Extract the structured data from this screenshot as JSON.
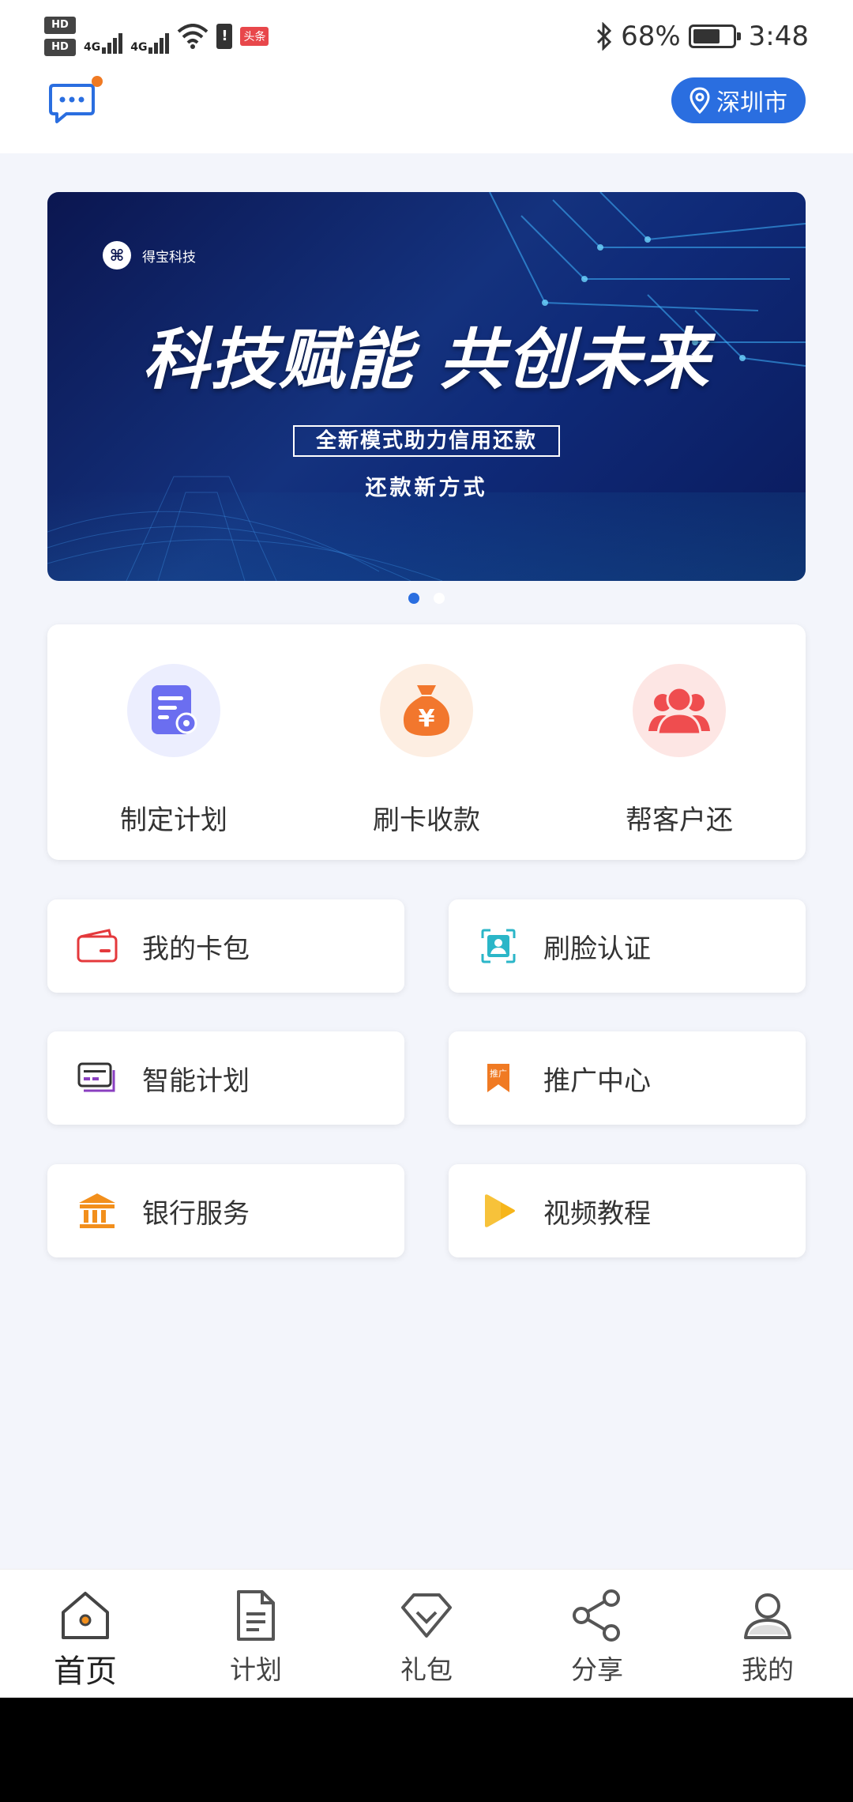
{
  "status_bar": {
    "hd1": "HD",
    "hd2": "HD",
    "net1": "4G",
    "net2": "4G",
    "app_badge": "头条",
    "battery_percent": "68%",
    "battery_level": 0.68,
    "time": "3:48"
  },
  "header": {
    "city": "深圳市",
    "has_unread_messages": true
  },
  "banner": {
    "brand": "得宝科技",
    "headline": "科技赋能 共创未来",
    "boxed_text": "全新模式助力信用还款",
    "subtitle": "还款新方式",
    "page_count": 2,
    "active_page": 1
  },
  "main_actions": [
    {
      "label": "制定计划",
      "icon": "plan-doc-icon"
    },
    {
      "label": "刷卡收款",
      "icon": "money-bag-icon"
    },
    {
      "label": "帮客户还",
      "icon": "users-icon"
    }
  ],
  "tiles": [
    {
      "label": "我的卡包",
      "icon": "card-wallet-icon"
    },
    {
      "label": "刷脸认证",
      "icon": "face-id-icon"
    },
    {
      "label": "智能计划",
      "icon": "smart-plan-icon"
    },
    {
      "label": "推广中心",
      "icon": "promo-bookmark-icon",
      "icon_text": "推广"
    },
    {
      "label": "银行服务",
      "icon": "bank-icon"
    },
    {
      "label": "视频教程",
      "icon": "video-play-icon"
    }
  ],
  "bottom_nav": [
    {
      "label": "首页",
      "icon": "home-icon",
      "active": true
    },
    {
      "label": "计划",
      "icon": "document-icon",
      "active": false
    },
    {
      "label": "礼包",
      "icon": "gift-diamond-icon",
      "active": false
    },
    {
      "label": "分享",
      "icon": "share-icon",
      "active": false
    },
    {
      "label": "我的",
      "icon": "profile-icon",
      "active": false
    }
  ],
  "colors": {
    "accent": "#2a6ee0",
    "notification_dot": "#f07a23",
    "background": "#f3f5fb"
  }
}
